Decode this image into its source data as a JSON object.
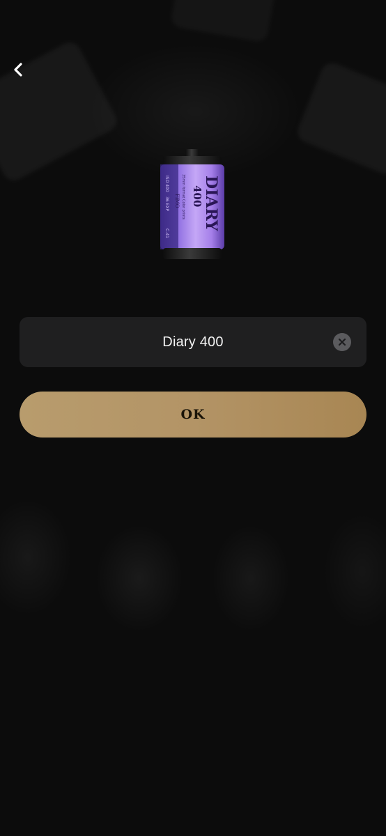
{
  "nav": {
    "back_icon": "chevron-left-icon"
  },
  "film": {
    "brand_title": "DIARY",
    "brand_number": "400",
    "subtitle": "35mm format Color prints",
    "maker": "FIMO",
    "iso": "ISO 400",
    "exposures": "36 EXP",
    "code": "C-41",
    "colors": {
      "body_light": "#c9a6f5",
      "body_mid": "#9b6ee8",
      "body_dark": "#3c2a7a",
      "cap": "#1a1a1a"
    }
  },
  "name_field": {
    "value": "Diary 400",
    "clear_icon": "clear-x-icon"
  },
  "ok_button": {
    "label": "OK",
    "color": "#b39466"
  }
}
